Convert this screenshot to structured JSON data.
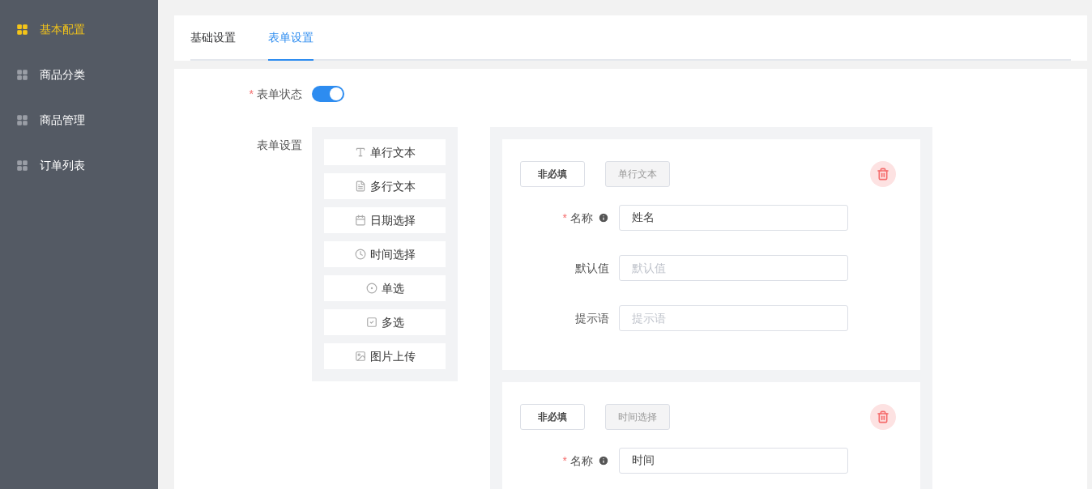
{
  "sidebar": {
    "items": [
      {
        "label": "基本配置",
        "selected": true
      },
      {
        "label": "商品分类",
        "selected": false
      },
      {
        "label": "商品管理",
        "selected": false
      },
      {
        "label": "订单列表",
        "selected": false
      }
    ]
  },
  "tabs": [
    {
      "label": "基础设置",
      "selected": false
    },
    {
      "label": "表单设置",
      "selected": true
    }
  ],
  "form_status": {
    "required_mark": "*",
    "label": "表单状态",
    "on": true
  },
  "form_settings": {
    "label": "表单设置",
    "palette": [
      {
        "kind": "text",
        "label": "单行文本"
      },
      {
        "kind": "textarea",
        "label": "多行文本"
      },
      {
        "kind": "date",
        "label": "日期选择"
      },
      {
        "kind": "time",
        "label": "时间选择"
      },
      {
        "kind": "radio",
        "label": "单选"
      },
      {
        "kind": "checkbox",
        "label": "多选"
      },
      {
        "kind": "image",
        "label": "图片上传"
      }
    ],
    "fields": [
      {
        "required_button": "非必填",
        "type_tag": "单行文本",
        "rows": [
          {
            "required_mark": "*",
            "label": "名称",
            "info": true,
            "value": "姓名"
          },
          {
            "label": "默认值",
            "info": false,
            "placeholder": "默认值"
          },
          {
            "label": "提示语",
            "info": false,
            "placeholder": "提示语"
          }
        ]
      },
      {
        "required_button": "非必填",
        "type_tag": "时间选择",
        "rows": [
          {
            "required_mark": "*",
            "label": "名称",
            "info": true,
            "value": "时间"
          }
        ]
      }
    ]
  }
}
